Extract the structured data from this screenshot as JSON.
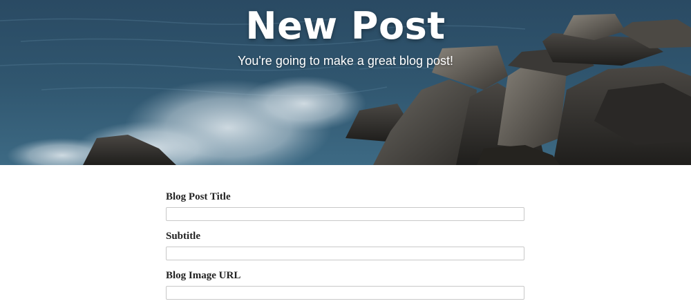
{
  "header": {
    "title": "New Post",
    "subtitle": "You're going to make a great blog post!"
  },
  "form": {
    "fields": [
      {
        "label": "Blog Post Title",
        "value": "",
        "placeholder": ""
      },
      {
        "label": "Subtitle",
        "value": "",
        "placeholder": ""
      },
      {
        "label": "Blog Image URL",
        "value": "",
        "placeholder": ""
      }
    ]
  }
}
